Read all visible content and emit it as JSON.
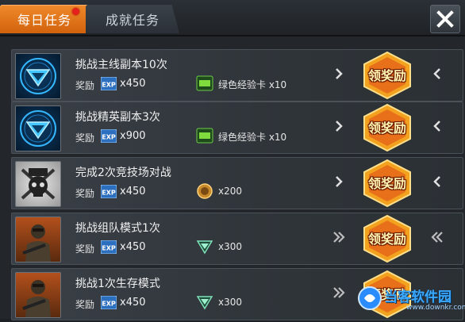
{
  "tabs": {
    "daily": "每日任务",
    "achievement": "成就任务"
  },
  "close": "✕",
  "reward_label": "奖励",
  "claim_label": "领奖励",
  "exp_icon_text": "EXP",
  "tasks": [
    {
      "title": "挑战主线副本10次",
      "exp": "x450",
      "extra": "绿色经验卡 x10",
      "extra_icon": "green-exp-card-icon",
      "avatar": "blue-triangle-emblem"
    },
    {
      "title": "挑战精英副本3次",
      "exp": "x900",
      "extra": "绿色经验卡 x10",
      "extra_icon": "green-exp-card-icon",
      "avatar": "blue-triangle-emblem"
    },
    {
      "title": "完成2次竞技场对战",
      "exp": "x450",
      "extra": "x200",
      "extra_icon": "pk-medal-icon",
      "avatar": "elite-skull-emblem"
    },
    {
      "title": "挑战组队模式1次",
      "exp": "x450",
      "extra": "x300",
      "extra_icon": "green-chevron-badge-icon",
      "avatar": "soldier-portrait"
    },
    {
      "title": "挑战1次生存模式",
      "exp": "x450",
      "extra": "x300",
      "extra_icon": "green-chevron-badge-icon",
      "avatar": "soldier-portrait"
    }
  ],
  "watermark": {
    "name": "当客软件园",
    "url": "www.downkr.com"
  },
  "colors": {
    "accent": "#e8781e",
    "panel": "#2f3439"
  }
}
